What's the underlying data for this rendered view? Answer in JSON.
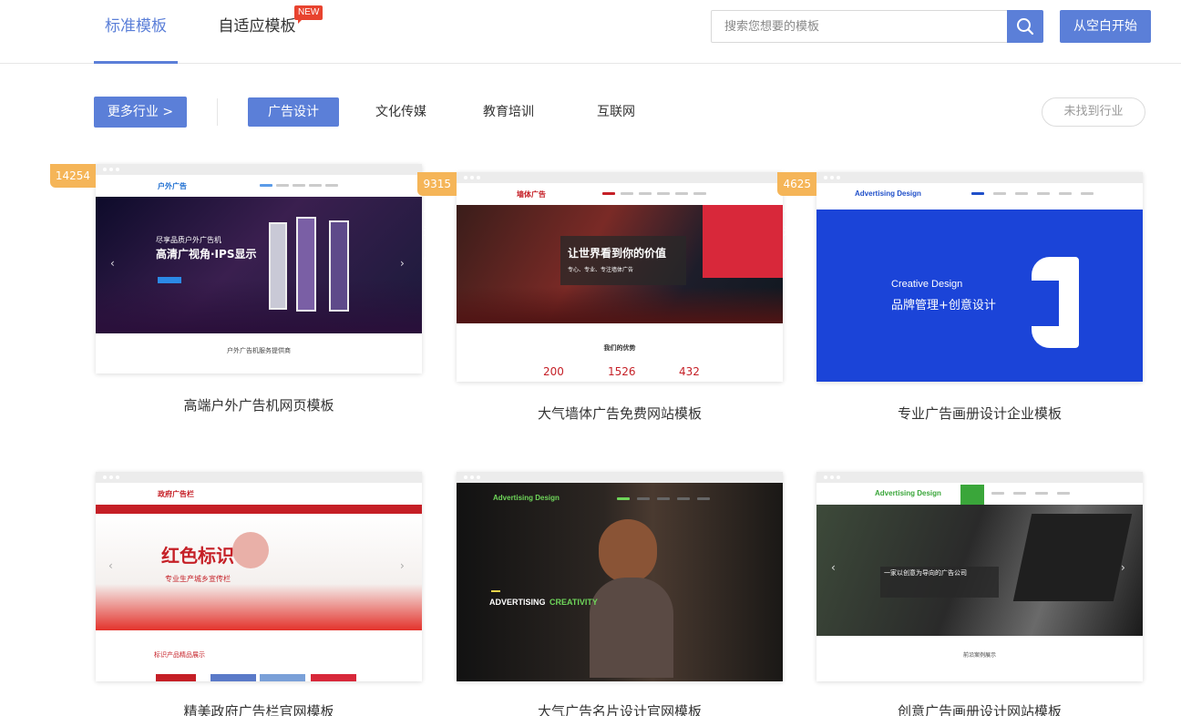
{
  "header": {
    "tabs": [
      {
        "label": "标准模板",
        "active": true
      },
      {
        "label": "自适应模板",
        "badge": "NEW"
      }
    ],
    "search": {
      "placeholder": "搜索您想要的模板"
    },
    "blank_button": "从空白开始"
  },
  "filters": {
    "more_button": "更多行业 >",
    "categories": [
      {
        "label": "广告设计",
        "active": true
      },
      {
        "label": "文化传媒"
      },
      {
        "label": "教育培训"
      },
      {
        "label": "互联网"
      }
    ],
    "not_found_button": "未找到行业"
  },
  "colors": {
    "accent": "#5b7fd8",
    "badge": "#f5b558",
    "new_badge": "#e8432f"
  },
  "templates": [
    {
      "title": "高端户外广告机网页模板",
      "usage": "14254人最近使用",
      "logo": "户外广告",
      "hero_line1": "尽享品质户外广告机",
      "hero_line2": "高清广视角·IPS显示",
      "section": "户外广告机服务提供商"
    },
    {
      "title": "大气墙体广告免费网站模板",
      "usage": "9315人最近使用",
      "logo": "墙体广告",
      "hero_line1": "让世界看到你的价值",
      "hero_line2": "专心、专业、专注墙体广告",
      "section": "我们的优势",
      "stats": [
        "200",
        "1526",
        "432"
      ]
    },
    {
      "title": "专业广告画册设计企业模板",
      "usage": "4625人最近使用",
      "logo": "Advertising Design",
      "hero_line1": "Creative Design",
      "hero_line2": "品牌管理+创意设计"
    },
    {
      "title": "精美政府广告栏官网模板",
      "logo": "政府广告栏",
      "hero_line1": "红色标识",
      "hero_line2": "专业生产城乡宣传栏",
      "section": "标识产品精品展示"
    },
    {
      "title": "大气广告名片设计官网模板",
      "logo": "Advertising Design",
      "hero_line1": "ADVERTISING",
      "hero_line2": "CREATIVITY"
    },
    {
      "title": "创意广告画册设计网站模板",
      "logo": "Advertising Design",
      "hero_line1": "一家以创意为导向的广告公司",
      "section": "前沿案例展示"
    }
  ]
}
